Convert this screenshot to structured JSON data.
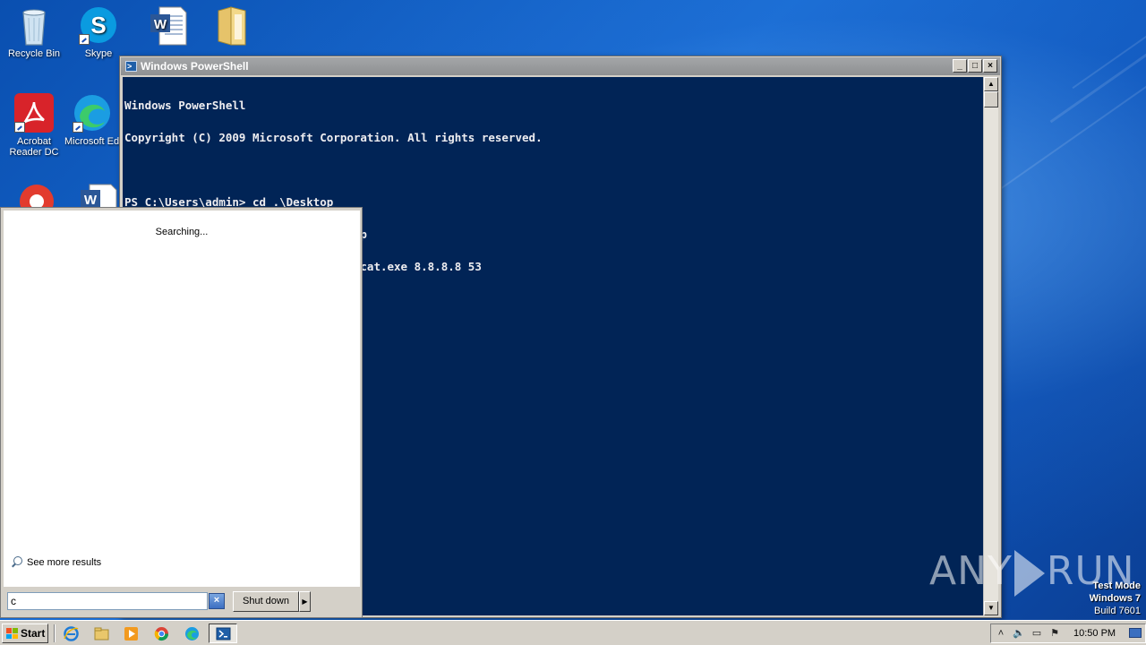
{
  "desktop": {
    "icons": [
      {
        "label": "Recycle Bin"
      },
      {
        "label": "Skype"
      },
      {
        "label": ""
      },
      {
        "label": ""
      },
      {
        "label": "Acrobat Reader DC"
      },
      {
        "label": "Microsoft Edge"
      }
    ]
  },
  "powershell": {
    "title": "Windows PowerShell",
    "minimize": "_",
    "maximize": "□",
    "close": "×",
    "console_lines": [
      "Windows PowerShell",
      "Copyright (C) 2009 Microsoft Corporation. All rights reserved.",
      "",
      "PS C:\\Users\\admin> cd .\\Desktop",
      "PS C:\\Users\\admin\\Desktop> cd .\\Nmap",
      "PS C:\\Users\\admin\\Desktop\\Nmap> .\\ncat.exe 8.8.8.8 53"
    ]
  },
  "start_menu": {
    "status": "Searching...",
    "see_more": "See more results",
    "search_value": "c",
    "shutdown_label": "Shut down"
  },
  "watermark": {
    "left": "ANY",
    "right": "RUN"
  },
  "test_mode": {
    "line1": "Test Mode",
    "line2": "Windows 7",
    "line3": "Build 7601"
  },
  "taskbar": {
    "start_label": "Start",
    "clock": "10:50 PM"
  }
}
